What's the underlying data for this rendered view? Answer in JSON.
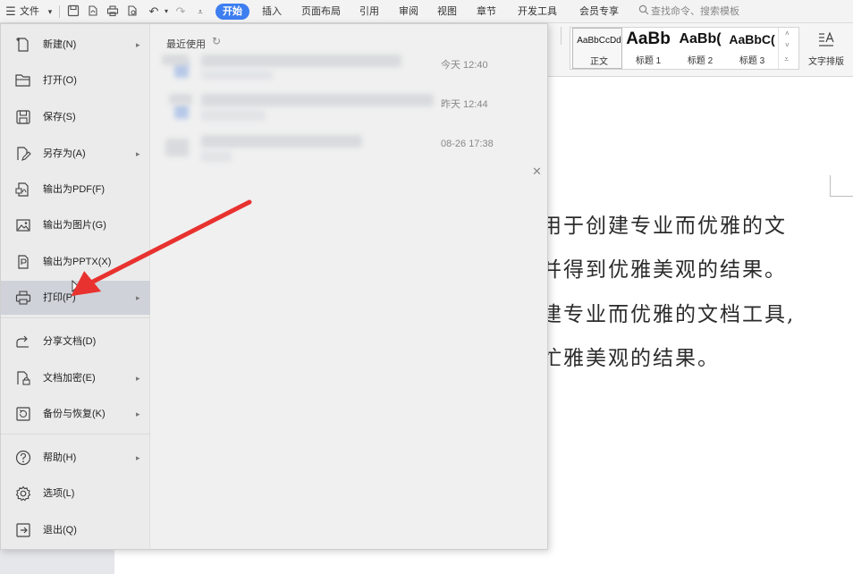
{
  "topbar": {
    "file_menu_label": "文件",
    "tabs": [
      {
        "label": "开始"
      },
      {
        "label": "插入"
      },
      {
        "label": "页面布局"
      },
      {
        "label": "引用"
      },
      {
        "label": "审阅"
      },
      {
        "label": "视图"
      },
      {
        "label": "章节"
      },
      {
        "label": "开发工具"
      },
      {
        "label": "会员专享"
      }
    ],
    "search_label": "查找命令、搜索模板"
  },
  "ribbon": {
    "styles": [
      {
        "sample": "AaBbCcDd",
        "name": "正文"
      },
      {
        "sample": "AaBb",
        "name": "标题 1"
      },
      {
        "sample": "AaBb(",
        "name": "标题 2"
      },
      {
        "sample": "AaBbC(",
        "name": "标题 3"
      }
    ],
    "text_layout_label": "文字排版"
  },
  "file_menu": {
    "items": [
      {
        "label": "新建(N)",
        "icon": "new-document-icon",
        "submenu": true
      },
      {
        "label": "打开(O)",
        "icon": "open-folder-icon",
        "submenu": false
      },
      {
        "label": "保存(S)",
        "icon": "save-icon",
        "submenu": false
      },
      {
        "label": "另存为(A)",
        "icon": "save-as-icon",
        "submenu": true
      },
      {
        "label": "输出为PDF(F)",
        "icon": "export-pdf-icon",
        "submenu": false
      },
      {
        "label": "输出为图片(G)",
        "icon": "export-image-icon",
        "submenu": false
      },
      {
        "label": "输出为PPTX(X)",
        "icon": "export-pptx-icon",
        "submenu": false
      },
      {
        "label": "打印(P)",
        "icon": "print-icon",
        "submenu": true,
        "active": true
      },
      {
        "label": "分享文档(D)",
        "icon": "share-icon",
        "submenu": false
      },
      {
        "label": "文档加密(E)",
        "icon": "encrypt-icon",
        "submenu": true
      },
      {
        "label": "备份与恢复(K)",
        "icon": "backup-icon",
        "submenu": true
      },
      {
        "label": "帮助(H)",
        "icon": "help-icon",
        "submenu": true
      },
      {
        "label": "选项(L)",
        "icon": "options-gear-icon",
        "submenu": false
      },
      {
        "label": "退出(Q)",
        "icon": "exit-icon",
        "submenu": false
      }
    ]
  },
  "recent": {
    "title": "最近使用",
    "items": [
      {
        "time": "今天 12:40"
      },
      {
        "time": "昨天 12:44"
      },
      {
        "time": "08-26 17:38"
      }
    ]
  },
  "document": {
    "lines": [
      "用于创建专业而优雅的文",
      "并得到优雅美观的结果。",
      "建专业而优雅的文档工具,",
      "忙雅美观的结果。"
    ]
  },
  "colors": {
    "accent": "#3d7ef0",
    "annotation_arrow": "#e8322f"
  }
}
